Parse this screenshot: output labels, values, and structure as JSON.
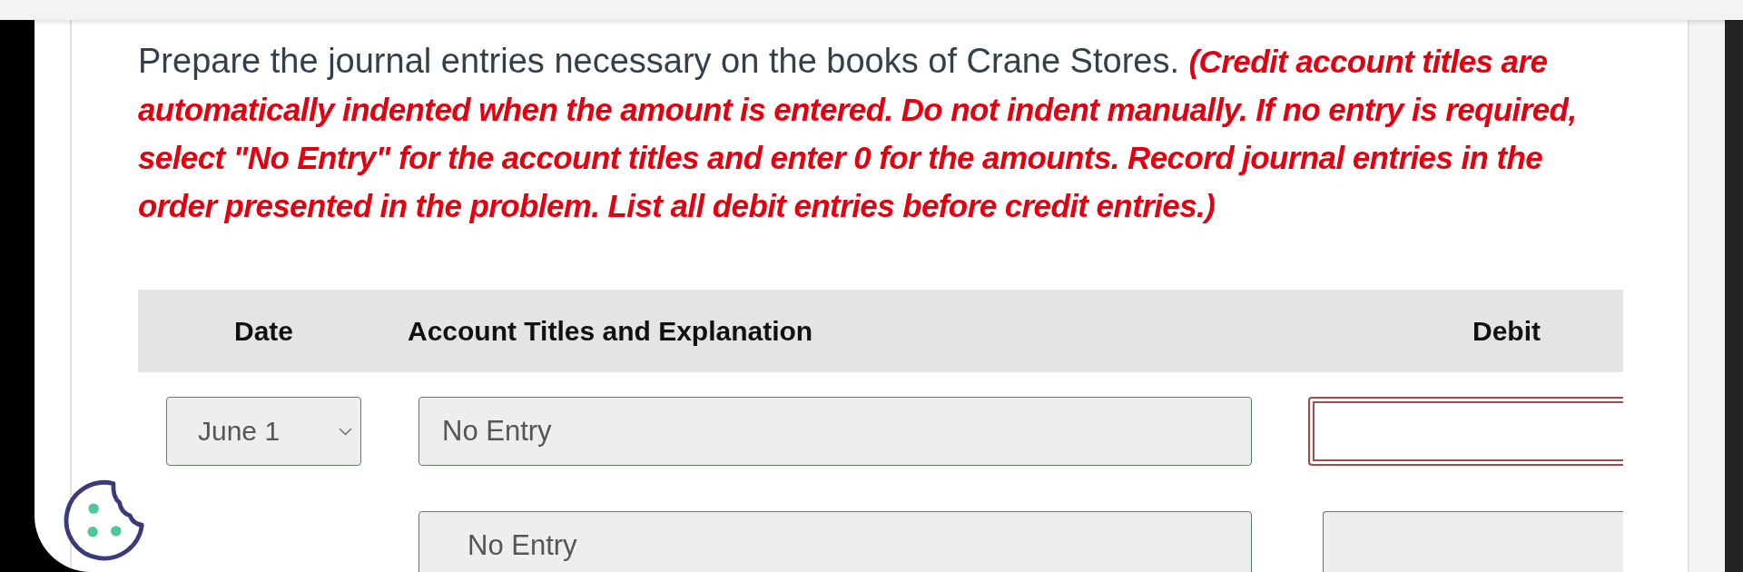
{
  "instructions": "Prepare the journal entries necessary on the books of Crane Stores. **(Credit account titles are automatically indented when the amount is entered. Do not indent manually. If no entry is required, select \"No Entry\" for the account titles and enter 0 for the amounts. Record journal entries in the order presented in the problem. List all debit entries before credit entries.)**",
  "table": {
    "columns": [
      "Date",
      "Account Titles and Explanation",
      "Debit"
    ],
    "rows": [
      {
        "date": "June 1",
        "account": "No Entry",
        "indented": false,
        "debit": {
          "invalid": true
        }
      },
      {
        "account": "No Entry",
        "indented": true,
        "debit": {
          "invalid": false
        }
      }
    ]
  }
}
